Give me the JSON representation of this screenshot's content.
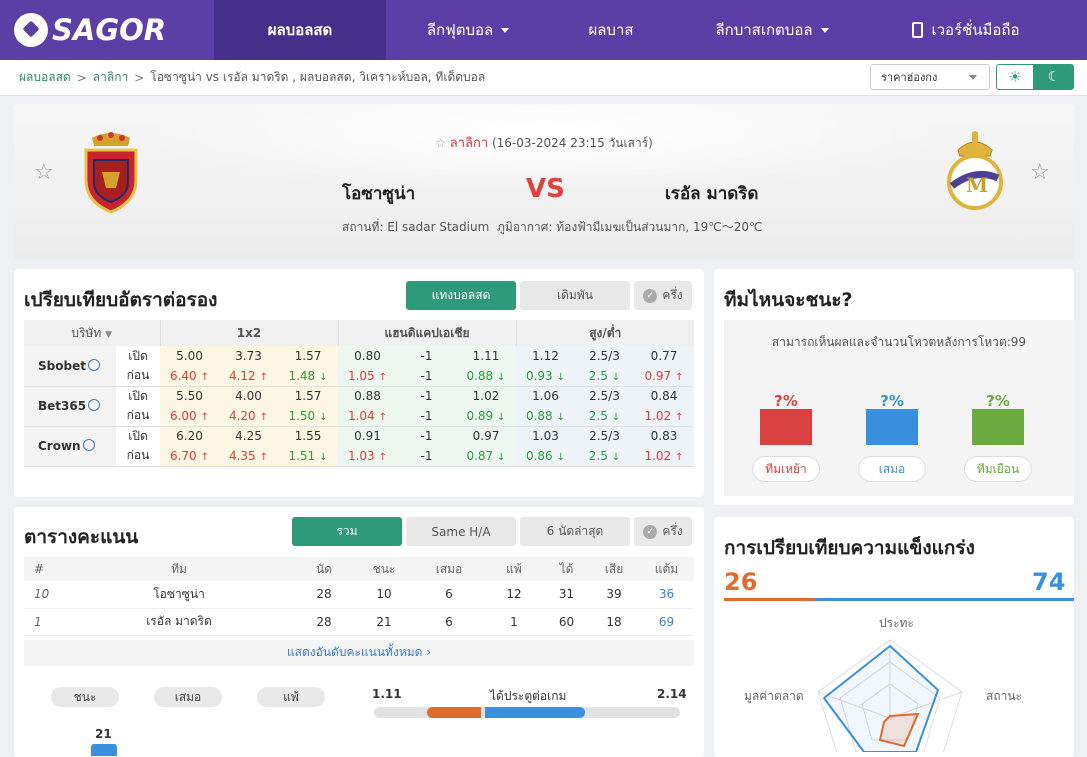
{
  "nav": {
    "logo": "SAGOR",
    "items": [
      "ผลบอลสด",
      "ลีกฟุตบอล",
      "ผลบาส",
      "ลีกบาสเกตบอล",
      "เวอร์ชั่นมือถือ"
    ]
  },
  "breadcrumb": {
    "home": "ผลบอลสด",
    "league": "ลาลิกา",
    "current": "โอซาซูน่า vs  เรอัล มาดริด ,  ผลบอลสด,  วิเคราะห์บอล,  ทีเด็ดบอล"
  },
  "odds_select": "ราคาฮ่องกง",
  "match": {
    "league": "ลาลิกา",
    "datetime": "(16-03-2024 23:15 วันเสาร์)",
    "home": "โอซาซูน่า",
    "away": "เรอัล มาดริด",
    "vs": "VS",
    "venue": "สถานที่: El sadar Stadium",
    "weather": "ภูมิอากาศ: ท้องฟ้ามีเมฆเป็นส่วนมาก, 19℃～20℃"
  },
  "odds": {
    "title": "เปรียบเทียบอัตราต่อรอง",
    "tabs": [
      "แทงบอลสด",
      "เดิมพัน"
    ],
    "half_label": "ครึ่ง",
    "headers": [
      "บริษัท",
      "1x2",
      "แฮนดิแคปเอเชีย",
      "สูง/ต่ำ"
    ],
    "open_label": "เปิด",
    "prev_label": "ก่อน",
    "rows": [
      {
        "name": "Sbobet",
        "open": [
          "5.00",
          "3.73",
          "1.57",
          "0.80",
          "-1",
          "1.11",
          "1.12",
          "2.5/3",
          "0.77"
        ],
        "prev": [
          "6.40",
          "4.12",
          "1.48",
          "1.05",
          "-1",
          "0.88",
          "0.93",
          "2.5",
          "0.97"
        ],
        "dir": [
          "u",
          "u",
          "d",
          "u",
          "",
          "d",
          "d",
          "d",
          "u"
        ]
      },
      {
        "name": "Bet365",
        "open": [
          "5.50",
          "4.00",
          "1.57",
          "0.88",
          "-1",
          "1.02",
          "1.06",
          "2.5/3",
          "0.84"
        ],
        "prev": [
          "6.00",
          "4.20",
          "1.50",
          "1.04",
          "-1",
          "0.89",
          "0.88",
          "2.5",
          "1.02"
        ],
        "dir": [
          "u",
          "u",
          "d",
          "u",
          "",
          "d",
          "d",
          "d",
          "u"
        ]
      },
      {
        "name": "Crown",
        "open": [
          "6.20",
          "4.25",
          "1.55",
          "0.91",
          "-1",
          "0.97",
          "1.03",
          "2.5/3",
          "0.83"
        ],
        "prev": [
          "6.70",
          "4.35",
          "1.51",
          "1.03",
          "-1",
          "0.87",
          "0.86",
          "2.5",
          "1.02"
        ],
        "dir": [
          "u",
          "u",
          "d",
          "u",
          "",
          "d",
          "d",
          "d",
          "u"
        ]
      }
    ]
  },
  "standings": {
    "title": "ตารางคะแนน",
    "tabs": [
      "รวม",
      "Same H/A",
      "6 นัดล่าสุด"
    ],
    "half_label": "ครึ่ง",
    "headers": [
      "#",
      "ทีม",
      "นัด",
      "ชนะ",
      "เสมอ",
      "แพ้",
      "ได้",
      "เสีย",
      "แต้ม"
    ],
    "rows": [
      [
        "10",
        "โอซาซูน่า",
        "28",
        "10",
        "6",
        "12",
        "31",
        "39",
        "36"
      ],
      [
        "1",
        "เรอัล มาดริด",
        "28",
        "21",
        "6",
        "1",
        "60",
        "18",
        "69"
      ]
    ],
    "more": "แสดงอันดับคะแนนทั้งหมด"
  },
  "results": {
    "pills": [
      "ชนะ",
      "เสมอ",
      "แพ้"
    ],
    "home_goals": "1.11",
    "label": "ได้ประตูต่อเกม",
    "away_goals": "2.14",
    "home_goals_share": 0.34,
    "bar_value": "21"
  },
  "vote": {
    "title": "ทีมไหนจะชนะ?",
    "subtitle": "สามารถเห็นผลและจำนวนโหวตหลังการโหวต:99",
    "pct": [
      "?%",
      "?%",
      "?%"
    ],
    "buttons": [
      "ทีมเหย้า",
      "เสมอ",
      "ทีมเยือน"
    ],
    "colors": [
      "#d94141",
      "#3a8fde",
      "#6aaa3f"
    ]
  },
  "strength": {
    "title": "การเปรียบเทียบความแข็งแกร่ง",
    "home": "26",
    "away": "74",
    "home_color": "#e06b2c",
    "away_color": "#3a8fde",
    "axes": [
      "ประทะ",
      "สถานะ",
      "มูลค่าตลาด"
    ]
  }
}
